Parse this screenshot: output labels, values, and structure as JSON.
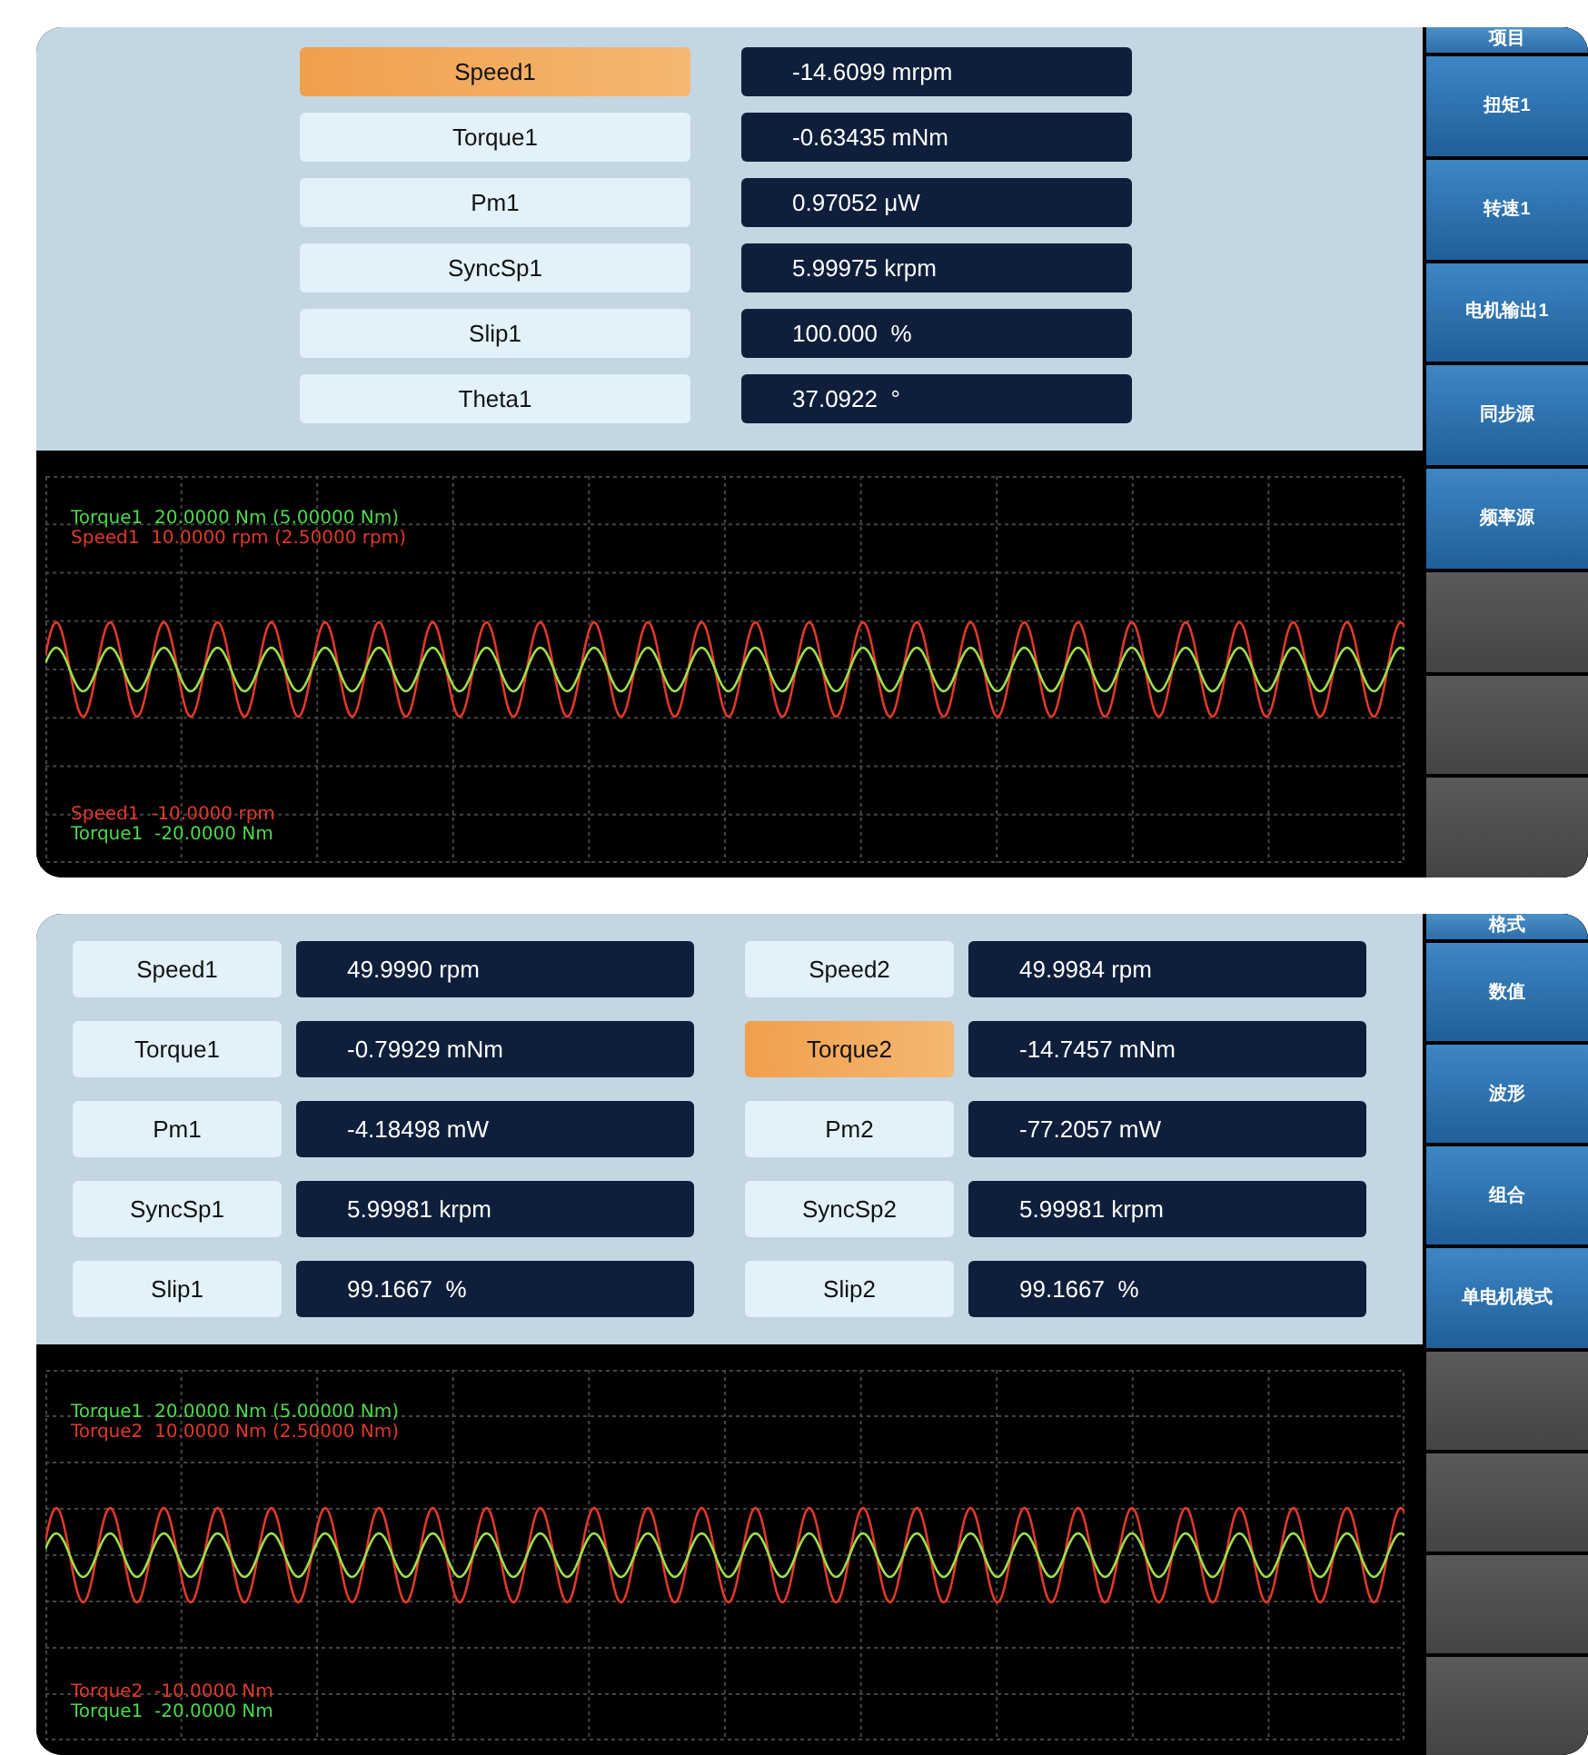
{
  "panels": [
    {
      "readings": {
        "columns": [
          [
            {
              "label": "Speed1",
              "value": "-14.6099 mrpm",
              "selected": true
            },
            {
              "label": "Torque1",
              "value": "-0.63435 mNm",
              "selected": false
            },
            {
              "label": "Pm1",
              "value": "0.97052 μW",
              "selected": false
            },
            {
              "label": "SyncSp1",
              "value": "5.99975 krpm",
              "selected": false
            },
            {
              "label": "Slip1",
              "value": "100.000  %",
              "selected": false
            },
            {
              "label": "Theta1",
              "value": "37.0922  °",
              "selected": false
            }
          ]
        ]
      },
      "scope": {
        "legend_top": [
          {
            "text": "Torque1  20.0000 Nm (5.00000 Nm)",
            "color": "#4cd94c"
          },
          {
            "text": "Speed1  10.0000 rpm (2.50000 rpm)",
            "color": "#e0392b"
          }
        ],
        "legend_bottom": [
          {
            "text": "Speed1  -10.0000 rpm",
            "color": "#e0392b"
          },
          {
            "text": "Torque1  -20.0000 Nm",
            "color": "#4cd94c"
          }
        ]
      },
      "sidebar": {
        "header": "项目",
        "buttons": [
          {
            "kind": "labeled",
            "label": "扭矩1"
          },
          {
            "kind": "labeled",
            "label": "转速1"
          },
          {
            "kind": "labeled",
            "label": "电机输出1"
          },
          {
            "kind": "labeled",
            "label": "同步源"
          },
          {
            "kind": "labeled",
            "label": "频率源"
          },
          {
            "kind": "empty"
          },
          {
            "kind": "empty"
          },
          {
            "kind": "empty"
          }
        ]
      }
    },
    {
      "readings": {
        "columns": [
          [
            {
              "label": "Speed1",
              "value": "49.9990 rpm",
              "selected": false
            },
            {
              "label": "Torque1",
              "value": "-0.79929 mNm",
              "selected": false
            },
            {
              "label": "Pm1",
              "value": "-4.18498 mW",
              "selected": false
            },
            {
              "label": "SyncSp1",
              "value": "5.99981 krpm",
              "selected": false
            },
            {
              "label": "Slip1",
              "value": "99.1667  %",
              "selected": false
            }
          ],
          [
            {
              "label": "Speed2",
              "value": "49.9984 rpm",
              "selected": false
            },
            {
              "label": "Torque2",
              "value": "-14.7457 mNm",
              "selected": true
            },
            {
              "label": "Pm2",
              "value": "-77.2057 mW",
              "selected": false
            },
            {
              "label": "SyncSp2",
              "value": "5.99981 krpm",
              "selected": false
            },
            {
              "label": "Slip2",
              "value": "99.1667  %",
              "selected": false
            }
          ]
        ]
      },
      "scope": {
        "legend_top": [
          {
            "text": "Torque1  20.0000 Nm (5.00000 Nm)",
            "color": "#4cd94c"
          },
          {
            "text": "Torque2  10.0000 Nm (2.50000 Nm)",
            "color": "#e0392b"
          }
        ],
        "legend_bottom": [
          {
            "text": "Torque2  -10.0000 Nm",
            "color": "#e0392b"
          },
          {
            "text": "Torque1  -20.0000 Nm",
            "color": "#4cd94c"
          }
        ]
      },
      "sidebar": {
        "header": "格式",
        "buttons": [
          {
            "kind": "labeled",
            "label": "数值"
          },
          {
            "kind": "labeled",
            "label": "波形"
          },
          {
            "kind": "labeled",
            "label": "组合"
          },
          {
            "kind": "labeled",
            "label": "单电机模式"
          },
          {
            "kind": "empty"
          },
          {
            "kind": "empty"
          },
          {
            "kind": "empty"
          },
          {
            "kind": "empty"
          }
        ]
      }
    }
  ]
}
